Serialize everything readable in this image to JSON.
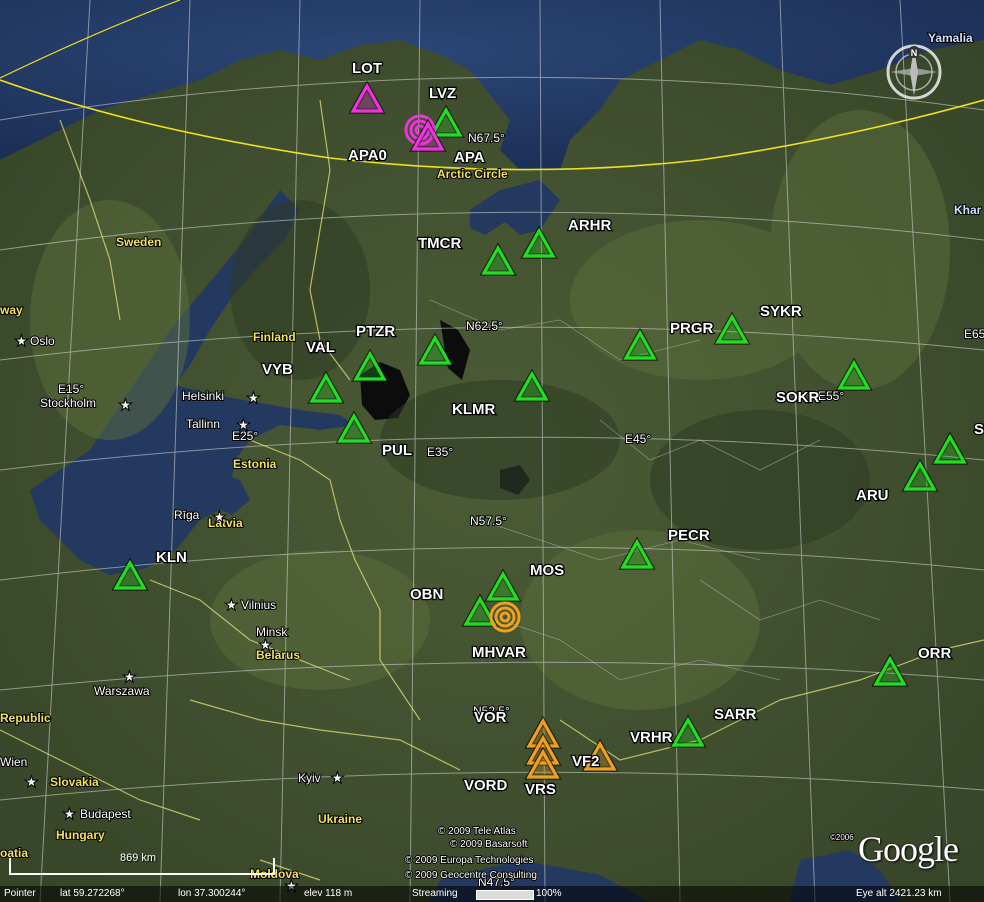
{
  "map": {
    "colors": {
      "sea": "#22375f",
      "land_dark": "#3a4a2e",
      "land_green": "#4e6336",
      "grid_line": "#d0d0d0",
      "border_line": "#e6e07a",
      "arctic_circle": "#f0e020",
      "station_green": "#22dd22",
      "station_magenta": "#ee33dd",
      "station_orange": "#f0a020"
    },
    "arctic_circle_label": "Arctic Circle",
    "grid_labels": [
      "N67.5°",
      "N62.5°",
      "N57.5°",
      "N52.5°",
      "N47.5°",
      "E15°",
      "E25°",
      "E35°",
      "E45°",
      "E55°",
      "E65°"
    ],
    "stations": [
      {
        "code": "LOT",
        "type": "triangle",
        "color": "magenta"
      },
      {
        "code": "LVZ",
        "type": "triangle",
        "color": "green"
      },
      {
        "code": "APA0",
        "type": "target",
        "color": "magenta"
      },
      {
        "code": "APA",
        "type": "triangle",
        "color": "magenta"
      },
      {
        "code": "TMCR",
        "type": "triangle",
        "color": "green"
      },
      {
        "code": "ARHR",
        "type": "triangle",
        "color": "green"
      },
      {
        "code": "PTZR",
        "type": "triangle",
        "color": "green"
      },
      {
        "code": "VAL",
        "type": "triangle",
        "color": "green"
      },
      {
        "code": "VYB",
        "type": "triangle",
        "color": "green"
      },
      {
        "code": "PUL",
        "type": "triangle",
        "color": "green"
      },
      {
        "code": "KLMR",
        "type": "triangle",
        "color": "green"
      },
      {
        "code": "PRGR",
        "type": "triangle",
        "color": "green"
      },
      {
        "code": "SYKR",
        "type": "triangle",
        "color": "green"
      },
      {
        "code": "SOKR",
        "type": "triangle",
        "color": "green"
      },
      {
        "code": "ARU",
        "type": "triangle",
        "color": "green"
      },
      {
        "code": "S",
        "type": "triangle",
        "color": "green"
      },
      {
        "code": "KLN",
        "type": "triangle",
        "color": "green"
      },
      {
        "code": "OBN",
        "type": "triangle",
        "color": "green"
      },
      {
        "code": "MOS",
        "type": "triangle",
        "color": "green"
      },
      {
        "code": "MHVAR",
        "type": "target",
        "color": "orange"
      },
      {
        "code": "PECR",
        "type": "triangle",
        "color": "green"
      },
      {
        "code": "ORR",
        "type": "triangle",
        "color": "green"
      },
      {
        "code": "VOR",
        "type": "triangle",
        "color": "orange"
      },
      {
        "code": "VORD",
        "type": "triangle",
        "color": "orange"
      },
      {
        "code": "VRS",
        "type": "triangle",
        "color": "orange"
      },
      {
        "code": "VF2",
        "type": "triangle",
        "color": "orange"
      },
      {
        "code": "VRHR",
        "type": "triangle",
        "color": "green"
      },
      {
        "code": "SARR",
        "type": "triangle",
        "color": "green"
      }
    ],
    "cities": [
      "Oslo",
      "Stockholm",
      "Helsinki",
      "Tallinn",
      "Rīga",
      "Vilnius",
      "Minsk",
      "Warszawa",
      "Kyiv",
      "Wien",
      "Budapest",
      "Moldova"
    ],
    "countries": [
      "Sweden",
      "Finland",
      "Estonia",
      "Latvia",
      "Belarus",
      "Ukraine",
      "Slovakia",
      "Hungary",
      "Republic",
      "way",
      "oatia",
      "Yamalia",
      "Khar"
    ],
    "credits": [
      "© 2009 Tele Atlas",
      "© 2009 Basarsoft",
      "© 2009 Europa Technologies",
      "© 2009 Geocentre Consulting"
    ],
    "image_year": "©2006",
    "scale_label": "869 km",
    "compass_label": "N",
    "logo": "Google"
  },
  "status_bar": {
    "pointer_label": "Pointer",
    "lat": "lat  59.272268°",
    "lon": "lon  37.300244°",
    "elev": "elev  118 m",
    "streaming": "Streaming",
    "streaming_pct": "100%",
    "eye_alt": "Eye alt   2421.23 km"
  }
}
